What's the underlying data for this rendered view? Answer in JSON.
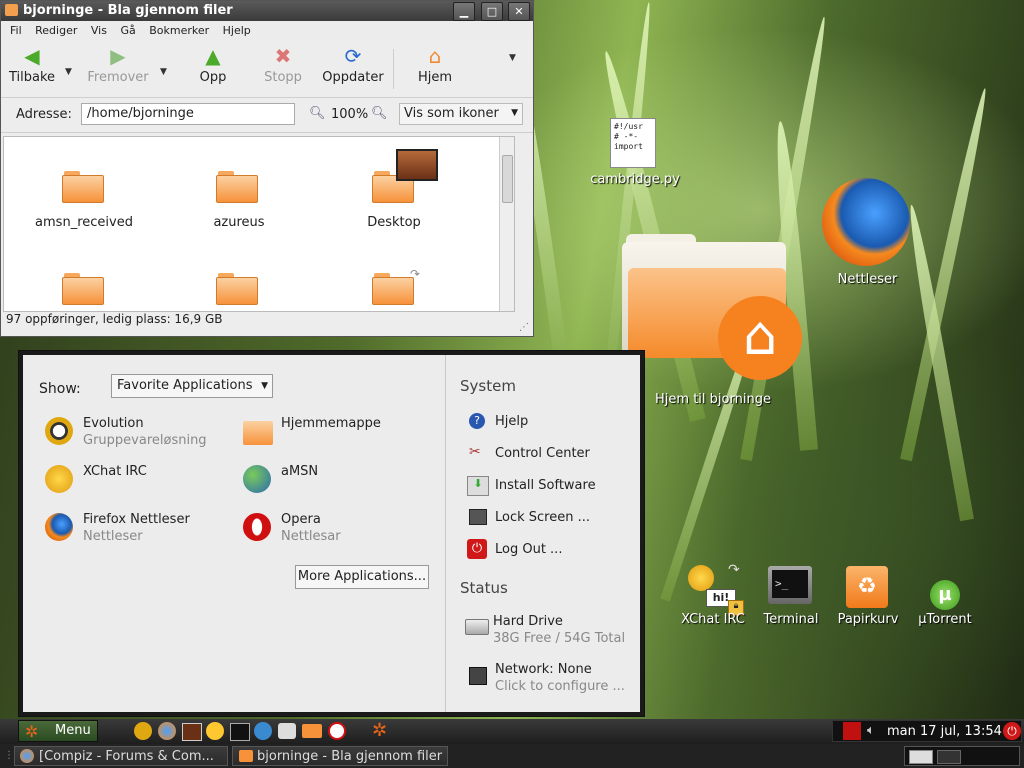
{
  "file_manager": {
    "title": "bjorninge - Bla gjennom filer",
    "menu": [
      "Fil",
      "Rediger",
      "Vis",
      "Gå",
      "Bokmerker",
      "Hjelp"
    ],
    "toolbar": {
      "back": "Tilbake",
      "forward": "Fremover",
      "up": "Opp",
      "stop": "Stopp",
      "reload": "Oppdater",
      "home": "Hjem"
    },
    "address_label": "Adresse:",
    "address_value": "/home/bjorninge",
    "zoom": "100%",
    "view_mode": "Vis som ikoner",
    "folders": [
      "amsn_received",
      "azureus",
      "Desktop"
    ],
    "status": "97 oppføringer, ledig plass: 16,9 GB"
  },
  "menu_panel": {
    "show_label": "Show:",
    "show_select": "Favorite Applications",
    "apps": [
      {
        "name": "Evolution",
        "sub": "Gruppevareløsning"
      },
      {
        "name": "Hjemmemappe",
        "sub": ""
      },
      {
        "name": "XChat IRC",
        "sub": ""
      },
      {
        "name": "aMSN",
        "sub": ""
      },
      {
        "name": "Firefox Nettleser",
        "sub": "Nettleser"
      },
      {
        "name": "Opera",
        "sub": "Nettlesar"
      }
    ],
    "more_button": "More Applications...",
    "system_header": "System",
    "system_items": [
      "Hjelp",
      "Control Center",
      "Install Software",
      "Lock Screen ...",
      "Log Out ..."
    ],
    "status_header": "Status",
    "status_items": [
      {
        "name": "Hard Drive",
        "sub": "38G Free / 54G Total"
      },
      {
        "name": "Network: None",
        "sub": "Click to configure ..."
      }
    ]
  },
  "desktop": {
    "script_icon_text": "#!/usr\n# -*-\nimport",
    "icons": {
      "cambridge": "cambridge.py",
      "browser": "Nettleser",
      "home": "Hjem til bjorninge",
      "xchat": "XChat IRC",
      "xchat_bubble": "hi!",
      "terminal": "Terminal",
      "trash": "Papirkurv",
      "utorrent": "µTorrent"
    }
  },
  "panel": {
    "menu_label": "Menu",
    "clock": "man 17 jul, 13:54",
    "tasks": [
      "[Compiz - Forums & Com...",
      "bjorninge - Bla gjennom filer"
    ]
  }
}
